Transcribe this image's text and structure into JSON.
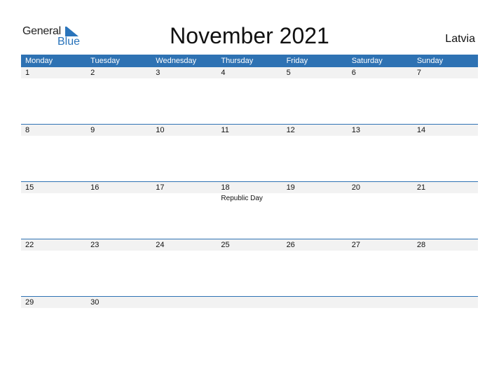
{
  "logo": {
    "general": "General",
    "blue": "Blue"
  },
  "title": "November 2021",
  "country": "Latvia",
  "colors": {
    "accent": "#2e72b3",
    "strip": "#f2f2f2"
  },
  "weekdays": [
    "Monday",
    "Tuesday",
    "Wednesday",
    "Thursday",
    "Friday",
    "Saturday",
    "Sunday"
  ],
  "weeks": [
    {
      "days": [
        "1",
        "2",
        "3",
        "4",
        "5",
        "6",
        "7"
      ],
      "events": [
        "",
        "",
        "",
        "",
        "",
        "",
        ""
      ]
    },
    {
      "days": [
        "8",
        "9",
        "10",
        "11",
        "12",
        "13",
        "14"
      ],
      "events": [
        "",
        "",
        "",
        "",
        "",
        "",
        ""
      ]
    },
    {
      "days": [
        "15",
        "16",
        "17",
        "18",
        "19",
        "20",
        "21"
      ],
      "events": [
        "",
        "",
        "",
        "Republic Day",
        "",
        "",
        ""
      ]
    },
    {
      "days": [
        "22",
        "23",
        "24",
        "25",
        "26",
        "27",
        "28"
      ],
      "events": [
        "",
        "",
        "",
        "",
        "",
        "",
        ""
      ]
    },
    {
      "days": [
        "29",
        "30",
        "",
        "",
        "",
        "",
        ""
      ],
      "events": [
        "",
        "",
        "",
        "",
        "",
        "",
        ""
      ]
    }
  ]
}
